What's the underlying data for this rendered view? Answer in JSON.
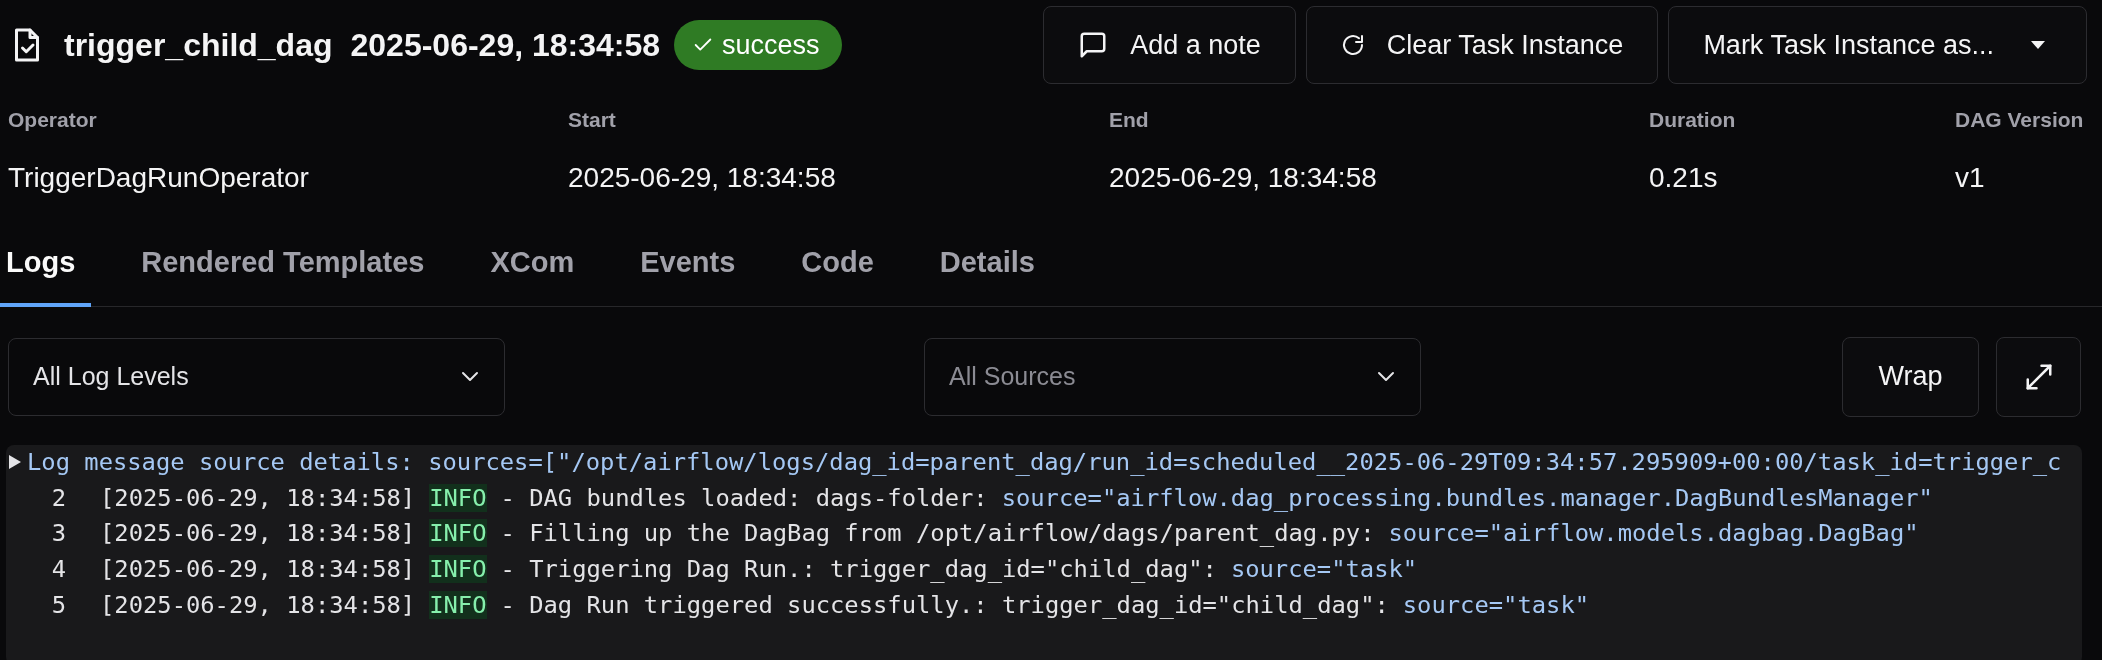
{
  "header": {
    "dag_task": "trigger_child_dag",
    "run_date": "2025-06-29, 18:34:58",
    "status": "success"
  },
  "actions": [
    {
      "kind": "note",
      "label": "Add a note"
    },
    {
      "kind": "clear",
      "label": "Clear Task Instance"
    },
    {
      "kind": "menu",
      "label": "Mark Task Instance as..."
    }
  ],
  "details": [
    {
      "label": "Operator",
      "value": "TriggerDagRunOperator"
    },
    {
      "label": "Start",
      "value": "2025-06-29, 18:34:58"
    },
    {
      "label": "End",
      "value": "2025-06-29, 18:34:58"
    },
    {
      "label": "Duration",
      "value": "0.21s"
    },
    {
      "label": "DAG Version",
      "value": "v1"
    }
  ],
  "tabs": [
    {
      "label": "Logs",
      "selected": true
    },
    {
      "label": "Rendered Templates",
      "selected": false
    },
    {
      "label": "XCom",
      "selected": false
    },
    {
      "label": "Events",
      "selected": false
    },
    {
      "label": "Code",
      "selected": false
    },
    {
      "label": "Details",
      "selected": false
    }
  ],
  "filters": {
    "log_levels": {
      "value": "All Log Levels"
    },
    "sources": {
      "placeholder": "All Sources"
    },
    "wrap_button": "Wrap"
  },
  "log": {
    "summary": {
      "text": "Log message source details: sources=[\"/opt/airflow/logs/dag_id=parent_dag/run_id=scheduled__2025-06-29T09:34:57.295909+00:00/task_id=trigger_c",
      "expanded": false
    },
    "lines": [
      {
        "number": "2",
        "timestamp": "[2025-06-29, 18:34:58]",
        "level": "INFO",
        "kind": "info",
        "message": "- DAG bundles loaded: dags-folder:",
        "source": "source=\"airflow.dag_processing.bundles.manager.DagBundlesManager\""
      },
      {
        "number": "3",
        "timestamp": "[2025-06-29, 18:34:58]",
        "level": "INFO",
        "kind": "info",
        "message": "- Filling up the DagBag from /opt/airflow/dags/parent_dag.py:",
        "source": "source=\"airflow.models.dagbag.DagBag\""
      },
      {
        "number": "4",
        "timestamp": "[2025-06-29, 18:34:58]",
        "level": "INFO",
        "kind": "info",
        "message": "- Triggering Dag Run.: trigger_dag_id=\"child_dag\":",
        "source": "source=\"task\""
      },
      {
        "number": "5",
        "timestamp": "[2025-06-29, 18:34:58]",
        "level": "INFO",
        "kind": "info",
        "message": "- Dag Run triggered successfully.: trigger_dag_id=\"child_dag\":",
        "source": "source=\"task\""
      }
    ]
  }
}
